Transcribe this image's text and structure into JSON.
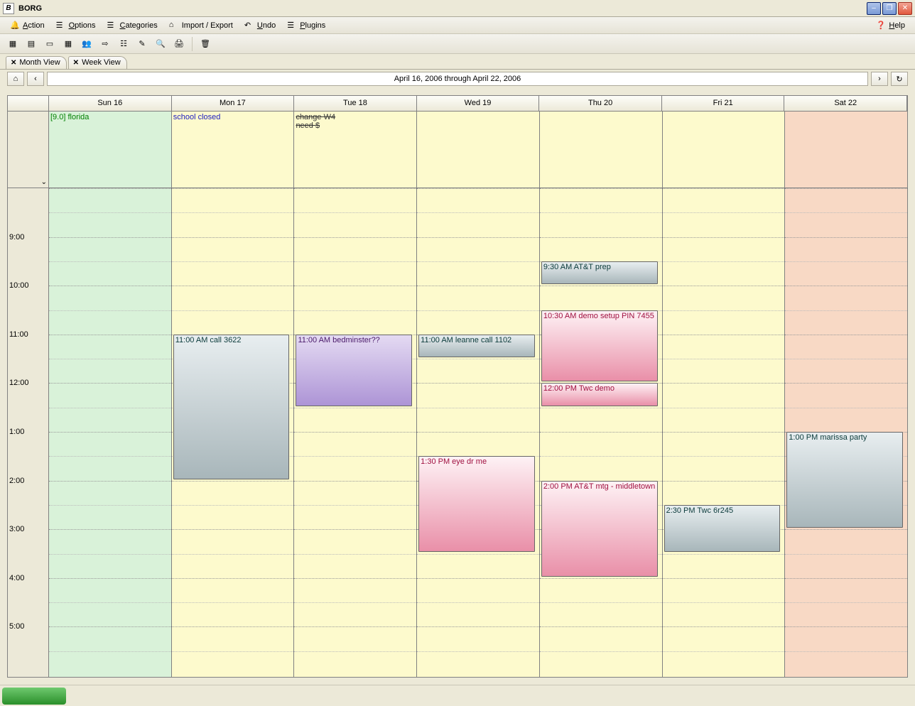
{
  "title": "BORG",
  "menu": {
    "action": "Action",
    "options": "Options",
    "categories": "Categories",
    "import_export": "Import / Export",
    "undo": "Undo",
    "plugins": "Plugins",
    "help": "Help"
  },
  "tabs": {
    "month": "Month View",
    "week": "Week View"
  },
  "date_range": "April 16, 2006 through April 22, 2006",
  "days": [
    "Sun 16",
    "Mon 17",
    "Tue 18",
    "Wed 19",
    "Thu 20",
    "Fri 21",
    "Sat 22"
  ],
  "hours": [
    "9:00",
    "10:00",
    "11:00",
    "12:00",
    "1:00",
    "2:00",
    "3:00",
    "4:00",
    "5:00"
  ],
  "allday": {
    "sun": [
      {
        "text": "[9.0] florida",
        "cls": "green"
      }
    ],
    "mon": [
      {
        "text": "school closed",
        "cls": "blue"
      }
    ],
    "tue": [
      {
        "text": "change W4",
        "cls": "strike"
      },
      {
        "text": "need $",
        "cls": "strike"
      }
    ],
    "wed": [],
    "thu": [],
    "fri": [],
    "sat": []
  },
  "events": {
    "mon": [
      {
        "label": "11:00 AM call 3622",
        "start": 3.0,
        "dur": 3.0,
        "cls": "gray"
      }
    ],
    "tue": [
      {
        "label": "11:00 AM bedminster??",
        "start": 3.0,
        "dur": 1.5,
        "cls": "purple"
      }
    ],
    "wed": [
      {
        "label": "11:00 AM leanne call 1102",
        "start": 3.0,
        "dur": 0.5,
        "cls": "gray"
      },
      {
        "label": "1:30 PM eye dr me",
        "start": 5.5,
        "dur": 2.0,
        "cls": "pink"
      }
    ],
    "thu": [
      {
        "label": "9:30 AM AT&T prep",
        "start": 1.5,
        "dur": 0.5,
        "cls": "gray"
      },
      {
        "label": "10:30 AM demo setup PIN 7455",
        "start": 2.5,
        "dur": 1.5,
        "cls": "pink"
      },
      {
        "label": "12:00 PM Twc demo",
        "start": 4.0,
        "dur": 0.5,
        "cls": "pink"
      },
      {
        "label": "2:00 PM AT&T mtg - middletown",
        "start": 6.0,
        "dur": 2.0,
        "cls": "pink"
      }
    ],
    "fri": [
      {
        "label": "2:30 PM Twc 6r245",
        "start": 6.5,
        "dur": 1.0,
        "cls": "gray"
      }
    ],
    "sat": [
      {
        "label": "1:00 PM marissa party",
        "start": 5.0,
        "dur": 2.0,
        "cls": "gray"
      }
    ],
    "sun": []
  }
}
